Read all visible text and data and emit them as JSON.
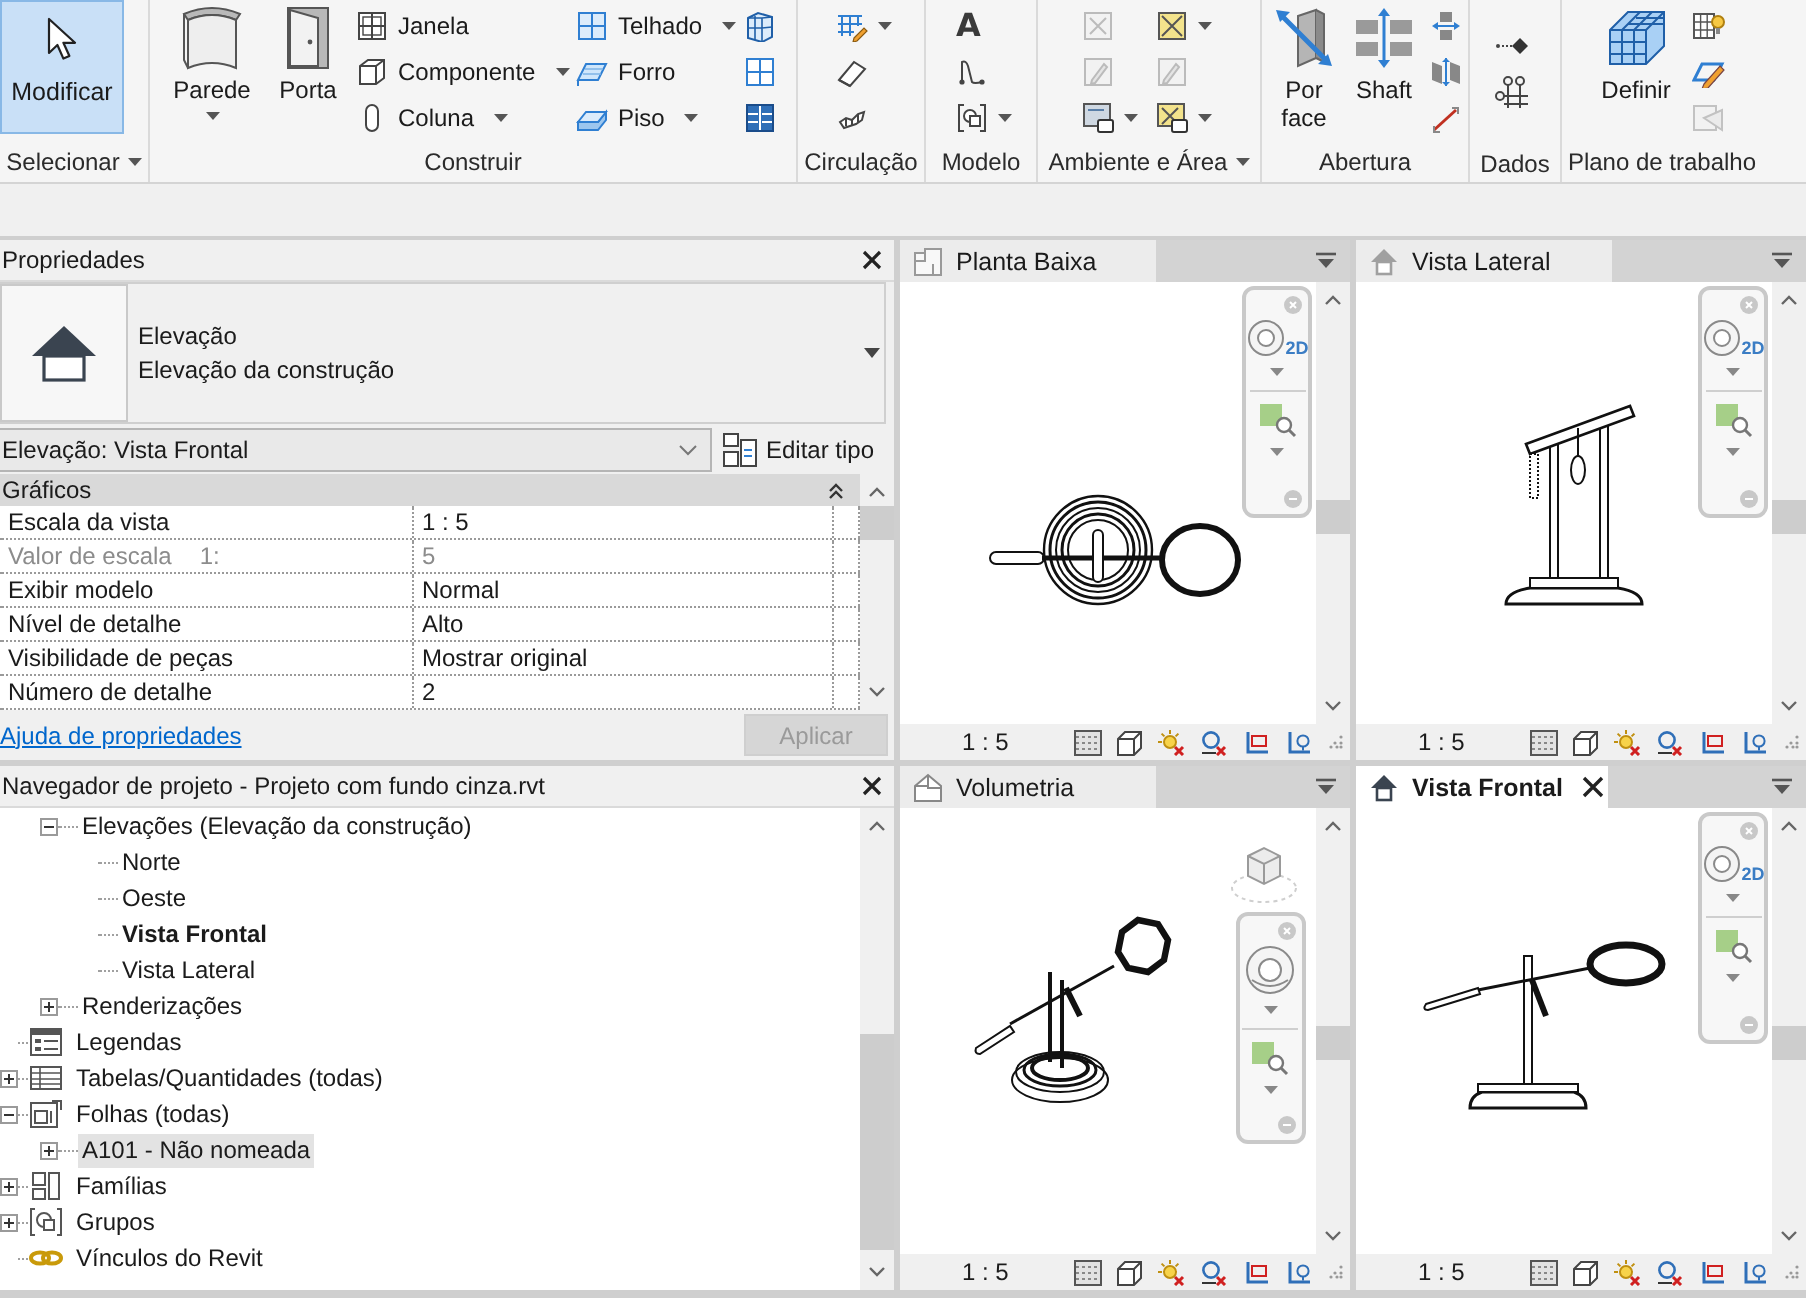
{
  "ribbon": {
    "panels": [
      {
        "title": "Selecionar",
        "menu": true,
        "buttons": [
          {
            "label": "Modificar",
            "selected": true,
            "dropdown": false
          }
        ]
      },
      {
        "title": "Construir",
        "menu": false,
        "buttons": [
          {
            "label": "Parede",
            "dropdown": true
          },
          {
            "label": "Porta",
            "dropdown": false
          },
          {
            "label": "Janela",
            "dropdown": false
          },
          {
            "label": "Componente",
            "dropdown": true
          },
          {
            "label": "Coluna",
            "dropdown": true
          },
          {
            "label": "Telhado",
            "dropdown": true
          },
          {
            "label": "Forro",
            "dropdown": false
          },
          {
            "label": "Piso",
            "dropdown": true
          }
        ]
      },
      {
        "title": "Circulação",
        "menu": false
      },
      {
        "title": "Modelo",
        "menu": false,
        "glyph": "A"
      },
      {
        "title": "Ambiente e Área",
        "menu": true
      },
      {
        "title": "Abertura",
        "menu": false,
        "buttons": [
          {
            "label": "Por face",
            "dropdown": false
          },
          {
            "label": "Shaft",
            "dropdown": false
          }
        ]
      },
      {
        "title": "Dados",
        "menu": false
      },
      {
        "title": "Plano de trabalho",
        "menu": false,
        "buttons": [
          {
            "label": "Definir",
            "dropdown": false
          }
        ]
      }
    ]
  },
  "properties": {
    "title": "Propriedades",
    "type_name": "Elevação",
    "type_family": "Elevação da construção",
    "instance": "Elevação: Vista Frontal",
    "edit_type": "Editar tipo",
    "group": {
      "label": "Gráficos",
      "expanded": true
    },
    "rows": [
      {
        "name": "Escala da vista",
        "value": "1 : 5",
        "disabled": false
      },
      {
        "name": "Valor de escala",
        "unit": "1:",
        "value": "5",
        "disabled": true
      },
      {
        "name": "Exibir modelo",
        "value": "Normal",
        "disabled": false
      },
      {
        "name": "Nível de detalhe",
        "value": "Alto",
        "disabled": false
      },
      {
        "name": "Visibilidade de peças",
        "value": "Mostrar original",
        "disabled": false
      },
      {
        "name": "Número de detalhe",
        "value": "2",
        "disabled": false
      }
    ],
    "help_link": "Ajuda de propriedades",
    "apply": {
      "label": "Aplicar",
      "disabled": true
    }
  },
  "browser": {
    "title": "Navegador de projeto - Projeto com fundo cinza.rvt",
    "tree": [
      {
        "children": [
          {
            "label": "Elevações (Elevação da construção)",
            "expanded": true,
            "selected": false,
            "active": false,
            "children": [
              {
                "label": "Norte",
                "selected": false,
                "active": false
              },
              {
                "label": "Oeste",
                "selected": false,
                "active": false
              },
              {
                "label": "Vista Frontal",
                "selected": false,
                "active": true
              },
              {
                "label": "Vista Lateral",
                "selected": false,
                "active": false
              }
            ]
          },
          {
            "label": "Renderizações",
            "expanded": false,
            "selected": false,
            "active": false
          }
        ]
      },
      {
        "label": "Legendas",
        "kind": "legends",
        "selected": false,
        "active": false
      },
      {
        "label": "Tabelas/Quantidades (todas)",
        "kind": "schedules",
        "expanded": false,
        "selected": false,
        "active": false
      },
      {
        "label": "Folhas (todas)",
        "kind": "sheets",
        "expanded": true,
        "selected": false,
        "active": false,
        "children": [
          {
            "label": "A101 - Não nomeada",
            "expanded": false,
            "selected": true,
            "active": false
          }
        ]
      },
      {
        "label": "Famílias",
        "kind": "families",
        "expanded": false,
        "selected": false,
        "active": false
      },
      {
        "label": "Grupos",
        "kind": "groups",
        "expanded": false,
        "selected": false,
        "active": false
      },
      {
        "label": "Vínculos do Revit",
        "kind": "links",
        "selected": false,
        "active": false
      }
    ]
  },
  "viewports": [
    {
      "title": "Planta Baixa",
      "kind": "plan",
      "selected": false,
      "wheel_label": "2D",
      "scale": "1 : 5"
    },
    {
      "title": "Vista Lateral",
      "kind": "side",
      "selected": false,
      "wheel_label": "2D",
      "scale": "1 : 5"
    },
    {
      "title": "Volumetria",
      "kind": "perspective",
      "selected": false,
      "scale": "1 : 5"
    },
    {
      "title": "Vista Frontal",
      "kind": "front",
      "selected": true,
      "wheel_label": "2D",
      "scale": "1 : 5"
    }
  ]
}
